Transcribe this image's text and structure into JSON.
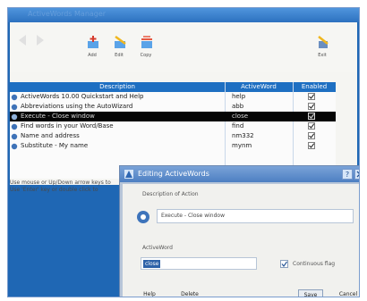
{
  "window": {
    "title": "ActiveWords Manager"
  },
  "toolbar": {
    "buttons": [
      {
        "label": "Add",
        "icon": "add-icon"
      },
      {
        "label": "Edit",
        "icon": "edit-icon"
      },
      {
        "label": "Copy",
        "icon": "copy-icon"
      },
      {
        "label": "Exit",
        "icon": "exit-icon"
      }
    ]
  },
  "grid": {
    "headers": [
      "Description",
      "ActiveWord",
      "Enabled"
    ],
    "rows": [
      {
        "desc": "ActiveWords 10.00 Quickstart and Help",
        "aw": "help",
        "enabled": true,
        "icon": "help-icon",
        "selected": false
      },
      {
        "desc": "Abbreviations using the AutoWizard",
        "aw": "abb",
        "enabled": true,
        "icon": "wizard-icon",
        "selected": false
      },
      {
        "desc": "Execute - Close window",
        "aw": "close",
        "enabled": true,
        "icon": "execute-icon",
        "selected": true
      },
      {
        "desc": "Find words in your Word/Base",
        "aw": "find",
        "enabled": true,
        "icon": "find-icon",
        "selected": false
      },
      {
        "desc": "Name and address",
        "aw": "nm332",
        "enabled": true,
        "icon": "text-icon",
        "selected": false
      },
      {
        "desc": "Substitute - My name",
        "aw": "mynm",
        "enabled": true,
        "icon": "text-icon",
        "selected": false
      }
    ]
  },
  "status": {
    "line1": "Use mouse or Up/Down arrow keys to",
    "line2": "Use 'Enter' key or double click to"
  },
  "dialog": {
    "title": "Editing ActiveWords",
    "description_label": "Description of Action",
    "description_value": "Execute - Close window",
    "activeword_label": "ActiveWord",
    "activeword_value": "close",
    "continuous_label": "Continuous flag",
    "continuous_checked": true,
    "help_label": "Help",
    "delete_label": "Delete",
    "save_label": "Save",
    "cancel_label": "Cancel"
  },
  "colors": {
    "frame": "#1f67b4",
    "header": "#1e6fc2",
    "selected_row": "#050505",
    "dialog_title": "#4d7fc2"
  }
}
